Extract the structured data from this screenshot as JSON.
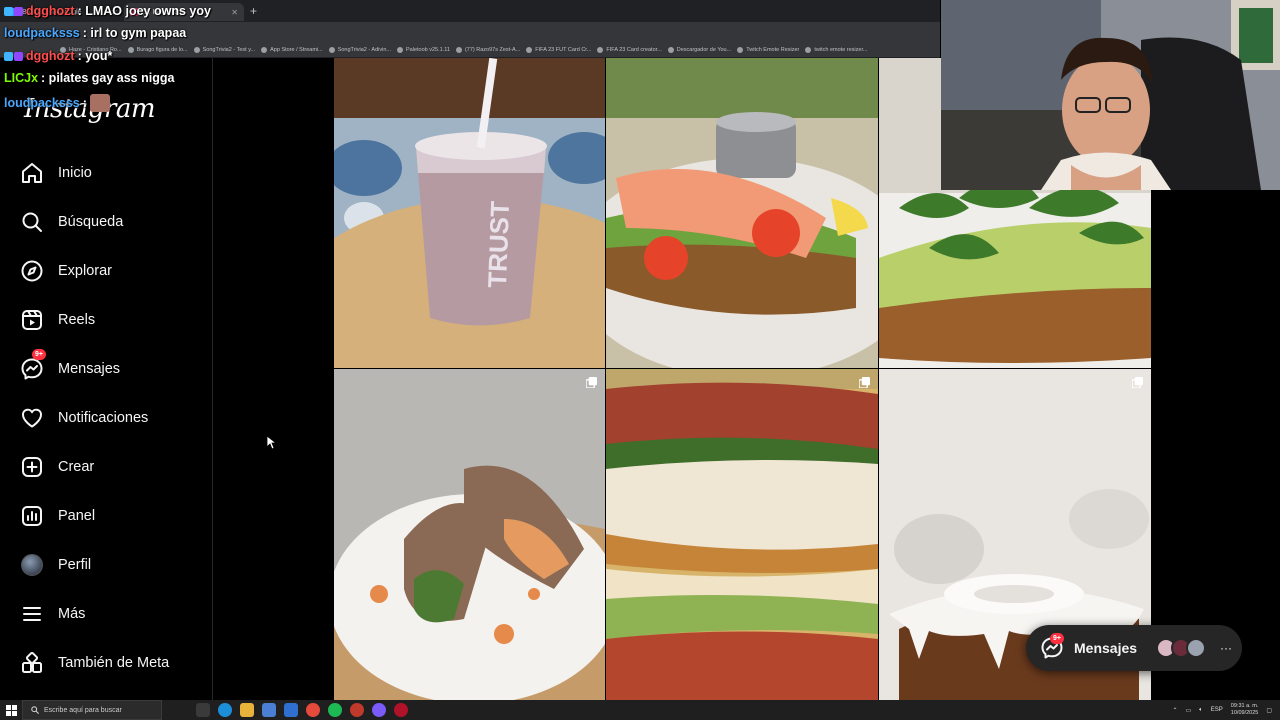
{
  "browser": {
    "tabs": [
      {
        "label": "Buscar con Google",
        "active": false
      },
      {
        "label": "(9) Instagram",
        "active": true
      }
    ],
    "new_tab": "+",
    "bookmarks": [
      "Haze - Cristiano Ro...",
      "Burago figura de lo...",
      "SongTrivia2 - Test y...",
      "App Store / Streami...",
      "SongTrivia2 - Adivin...",
      "Paletoob v25.1.11",
      "(77) Razo97s Zest-A...",
      "FIFA 23 FUT Card Cr...",
      "FIFA 23 Card creator...",
      "Descargador de You...",
      "Twitch Emote Resizer",
      "twitch emote resizer..."
    ]
  },
  "chat": [
    {
      "user": "dgghozt",
      "message": ": LMAO joey owns yoy"
    },
    {
      "user": "loudpacksss",
      "message": ": irl to gym papaa"
    },
    {
      "user": "dgghozt",
      "message": ": you*"
    },
    {
      "user": "LICJx",
      "message": ": pilates gay ass nigga"
    },
    {
      "user": "loudpacksss",
      "message": ":"
    }
  ],
  "sidebar": {
    "logo": "Instagram",
    "items": [
      {
        "label": "Inicio",
        "icon": "home-icon"
      },
      {
        "label": "Búsqueda",
        "icon": "search-icon"
      },
      {
        "label": "Explorar",
        "icon": "compass-icon"
      },
      {
        "label": "Reels",
        "icon": "reels-icon"
      },
      {
        "label": "Mensajes",
        "icon": "messenger-icon",
        "badge": "9+"
      },
      {
        "label": "Notificaciones",
        "icon": "heart-icon"
      },
      {
        "label": "Crear",
        "icon": "plus-square-icon"
      },
      {
        "label": "Panel",
        "icon": "chart-icon"
      },
      {
        "label": "Perfil",
        "icon": "avatar"
      },
      {
        "label": "Más",
        "icon": "menu-icon"
      },
      {
        "label": "También de Meta",
        "icon": "meta-apps-icon"
      }
    ]
  },
  "grid": {
    "posts": [
      {
        "subject": "smoothie cup",
        "cup_text": "TRUST",
        "multi": false
      },
      {
        "subject": "salmon avocado toast",
        "multi": false
      },
      {
        "subject": "avocado arugula toast",
        "multi": false
      },
      {
        "subject": "wrap with sauce",
        "multi": true
      },
      {
        "subject": "bacon bagel sandwich",
        "multi": true
      },
      {
        "subject": "glazed cake",
        "multi": true
      }
    ]
  },
  "messages_button": {
    "label": "Mensajes",
    "badge": "9+",
    "more": "···"
  },
  "taskbar": {
    "search_placeholder": "Escribe aquí para buscar",
    "language": "ESP",
    "time": "09:31 a. m.",
    "date": "10/09/2025"
  },
  "colors": {
    "instagram_bg": "#000000",
    "badge_red": "#ff3040",
    "chat_user_blue": "#4aa8ff"
  }
}
